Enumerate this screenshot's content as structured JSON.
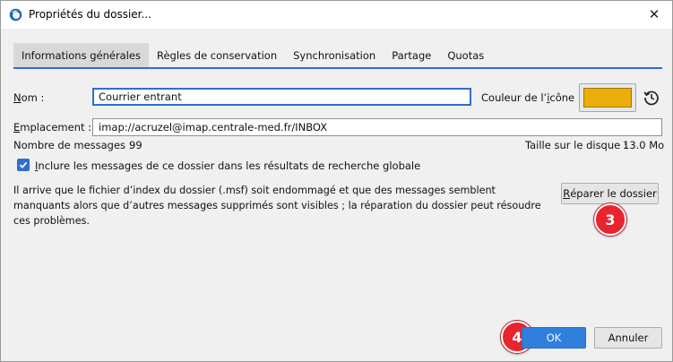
{
  "window": {
    "title": "Propriétés du dossier...",
    "close_glyph": "✕"
  },
  "tabs": [
    {
      "label": "Informations générales",
      "active": true
    },
    {
      "label": "Règles de conservation",
      "active": false
    },
    {
      "label": "Synchronisation",
      "active": false
    },
    {
      "label": "Partage",
      "active": false
    },
    {
      "label": "Quotas",
      "active": false
    }
  ],
  "form": {
    "name_label_u": "N",
    "name_label_rest": "om :",
    "name_value": "Courrier entrant",
    "icon_color_label_pre": "Couleur de l’",
    "icon_color_label_u": "i",
    "icon_color_label_post": "cône :",
    "icon_color": "#ebae0a",
    "location_label_u": "E",
    "location_label_rest": "mplacement :",
    "location_value": "imap://acruzel@imap.centrale-med.fr/INBOX",
    "messages_label": "Nombre de messages :",
    "messages_value": "99",
    "disk_label": "Taille sur le disque :",
    "disk_value": "13.0 Mo",
    "include_u": "I",
    "include_rest": "nclure les messages de ce dossier dans les résultats de recherche globale",
    "include_checked": true,
    "repair_text": "Il arrive que le fichier d’index du dossier (.msf) soit endommagé et que des messages semblent manquants alors que d’autres messages supprimés sont visibles ; la réparation du dossier peut résoudre ces problèmes.",
    "repair_btn_u": "R",
    "repair_btn_rest": "éparer le dossier"
  },
  "footer": {
    "ok_label": "OK",
    "cancel_label": "Annuler"
  },
  "markers": {
    "step3": "3",
    "step4": "4"
  },
  "colors": {
    "accent": "#2f6dd0",
    "marker": "#e8242e"
  }
}
